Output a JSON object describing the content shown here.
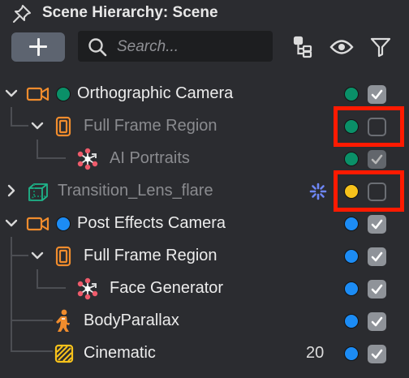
{
  "panel": {
    "title": "Scene Hierarchy: Scene",
    "pin_icon": "pin-icon"
  },
  "toolbar": {
    "add_icon": "plus-icon",
    "search_placeholder": "Search...",
    "search_icon": "search-icon",
    "icons": [
      "hierarchy-filter-icon",
      "eye-icon",
      "filter-icon"
    ]
  },
  "colors": {
    "green": "#0a9068",
    "blue": "#1c8cf5",
    "yellow": "#f7c21b",
    "orange": "#f08c2d",
    "highlight": "#ff1a00"
  },
  "rows": [
    {
      "label": "Orthographic Camera",
      "icon": "camera-icon",
      "expanded": true,
      "status": "green",
      "enabled": true,
      "dimmed": false
    },
    {
      "label": "Full Frame Region",
      "icon": "region-icon",
      "expanded": true,
      "status": "green",
      "enabled": false,
      "dimmed": true,
      "highlighted": true
    },
    {
      "label": "AI Portraits",
      "icon": "face-mesh-icon",
      "status": "green",
      "enabled": true,
      "dimmed": true
    },
    {
      "label": "Transition_Lens_flare",
      "icon": "cube-icon",
      "expanded": false,
      "status": "yellow",
      "enabled": false,
      "dimmed": true,
      "highlighted": true,
      "extra_icon": "sparkle-icon"
    },
    {
      "label": "Post Effects Camera",
      "icon": "camera-icon",
      "expanded": true,
      "status": "blue",
      "enabled": true,
      "dimmed": false
    },
    {
      "label": "Full Frame Region",
      "icon": "region-icon",
      "expanded": true,
      "status": "blue",
      "enabled": true,
      "dimmed": false
    },
    {
      "label": "Face Generator",
      "icon": "face-mesh-icon",
      "status": "blue",
      "enabled": true,
      "dimmed": false
    },
    {
      "label": "BodyParallax",
      "icon": "person-icon",
      "status": "blue",
      "enabled": true,
      "dimmed": false
    },
    {
      "label": "Cinematic",
      "icon": "hatched-square-icon",
      "status": "blue",
      "enabled": true,
      "dimmed": false,
      "count": "20"
    }
  ]
}
